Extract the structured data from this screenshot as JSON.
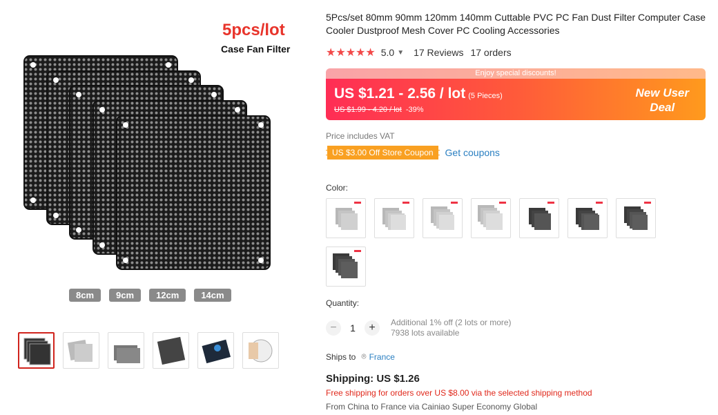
{
  "gallery": {
    "promo_title": "5pcs/lot",
    "promo_subtitle": "Case Fan Filter",
    "size_tags": [
      "8cm",
      "9cm",
      "12cm",
      "14cm"
    ],
    "thumbnails": [
      "thumb-1",
      "thumb-2",
      "thumb-3",
      "thumb-4",
      "thumb-5",
      "thumb-6"
    ]
  },
  "product": {
    "title": "5Pcs/set 80mm 90mm 120mm 140mm Cuttable PVC PC Fan Dust Filter Computer Case Cooler Dustproof Mesh Cover PC Cooling Accessories",
    "rating": "5.0",
    "stars": "★★★★★",
    "reviews": "17 Reviews",
    "orders": "17 orders"
  },
  "deal": {
    "banner_top": "Enjoy special discounts!",
    "price": "US $1.21 - 2.56 / lot",
    "pieces": "(5 Pieces)",
    "old_price": "US $1.99 - 4.20 / lot",
    "discount": "-39%",
    "new_user_line1": "New User",
    "new_user_line2": "Deal"
  },
  "vat_note": "Price includes VAT",
  "coupon": {
    "label": "US $3.00 Off Store Coupon",
    "link": "Get coupons"
  },
  "color": {
    "label": "Color:",
    "options": [
      "light-1",
      "light-2",
      "light-3",
      "light-4",
      "dark-1",
      "dark-2",
      "dark-3",
      "dark-4"
    ]
  },
  "quantity": {
    "label": "Quantity:",
    "minus": "−",
    "value": "1",
    "plus": "+",
    "note1": "Additional 1% off (2 lots or more)",
    "note2": "7938 lots available"
  },
  "ships_to": {
    "label": "Ships to",
    "icon": "pin-icon",
    "country": "France"
  },
  "shipping": {
    "title": "Shipping: US $1.26",
    "free": "Free shipping for orders over US $8.00 via the selected shipping method",
    "from": "From China to France via Cainiao Super Economy Global"
  },
  "colors": {
    "accent_red": "#e8342b",
    "link_blue": "#2a7fc1",
    "coupon_orange": "#f9a021"
  }
}
